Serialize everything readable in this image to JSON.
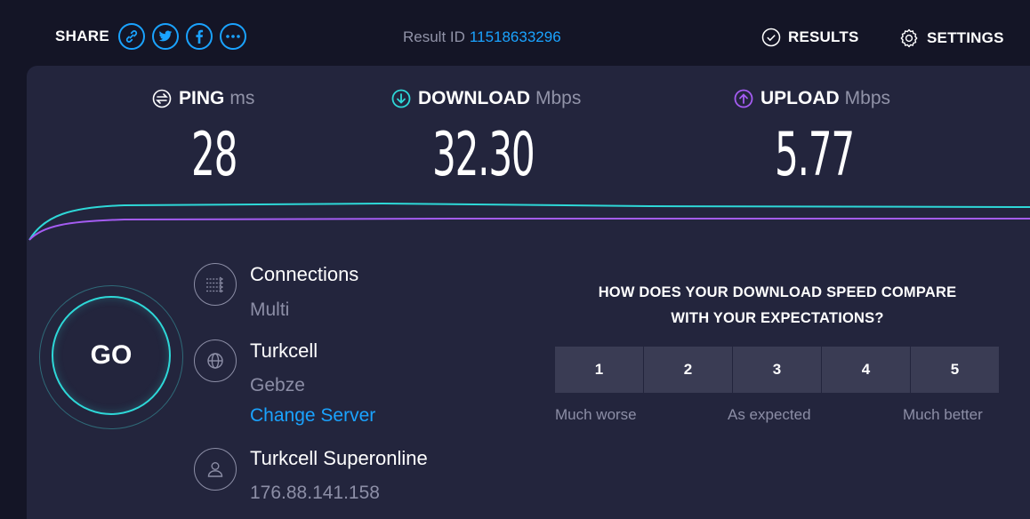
{
  "share": {
    "label": "SHARE",
    "buttons": [
      "link-icon",
      "twitter-icon",
      "facebook-icon",
      "more-icon"
    ]
  },
  "result": {
    "label": "Result ID",
    "id": "11518633296"
  },
  "nav": {
    "results": "RESULTS",
    "settings": "SETTINGS"
  },
  "metrics": {
    "ping": {
      "name": "PING",
      "unit": "ms",
      "value": "28",
      "icon": "ping-icon"
    },
    "download": {
      "name": "DOWNLOAD",
      "unit": "Mbps",
      "value": "32.30",
      "icon": "download-icon"
    },
    "upload": {
      "name": "UPLOAD",
      "unit": "Mbps",
      "value": "5.77",
      "icon": "upload-icon"
    }
  },
  "go": {
    "label": "GO"
  },
  "connections": {
    "title": "Connections",
    "value": "Multi"
  },
  "server": {
    "name": "Turkcell",
    "location": "Gebze",
    "change_label": "Change Server"
  },
  "provider": {
    "name": "Turkcell Superonline",
    "ip": "176.88.141.158"
  },
  "survey": {
    "question_line1": "HOW DOES YOUR DOWNLOAD SPEED COMPARE",
    "question_line2": "WITH YOUR EXPECTATIONS?",
    "options": [
      "1",
      "2",
      "3",
      "4",
      "5"
    ],
    "label_low": "Much worse",
    "label_mid": "As expected",
    "label_high": "Much better"
  },
  "colors": {
    "accent": "#1aa3ff",
    "download": "#2ed8d8",
    "upload": "#a45cf2",
    "background": "#141526",
    "panel": "#23253d"
  }
}
